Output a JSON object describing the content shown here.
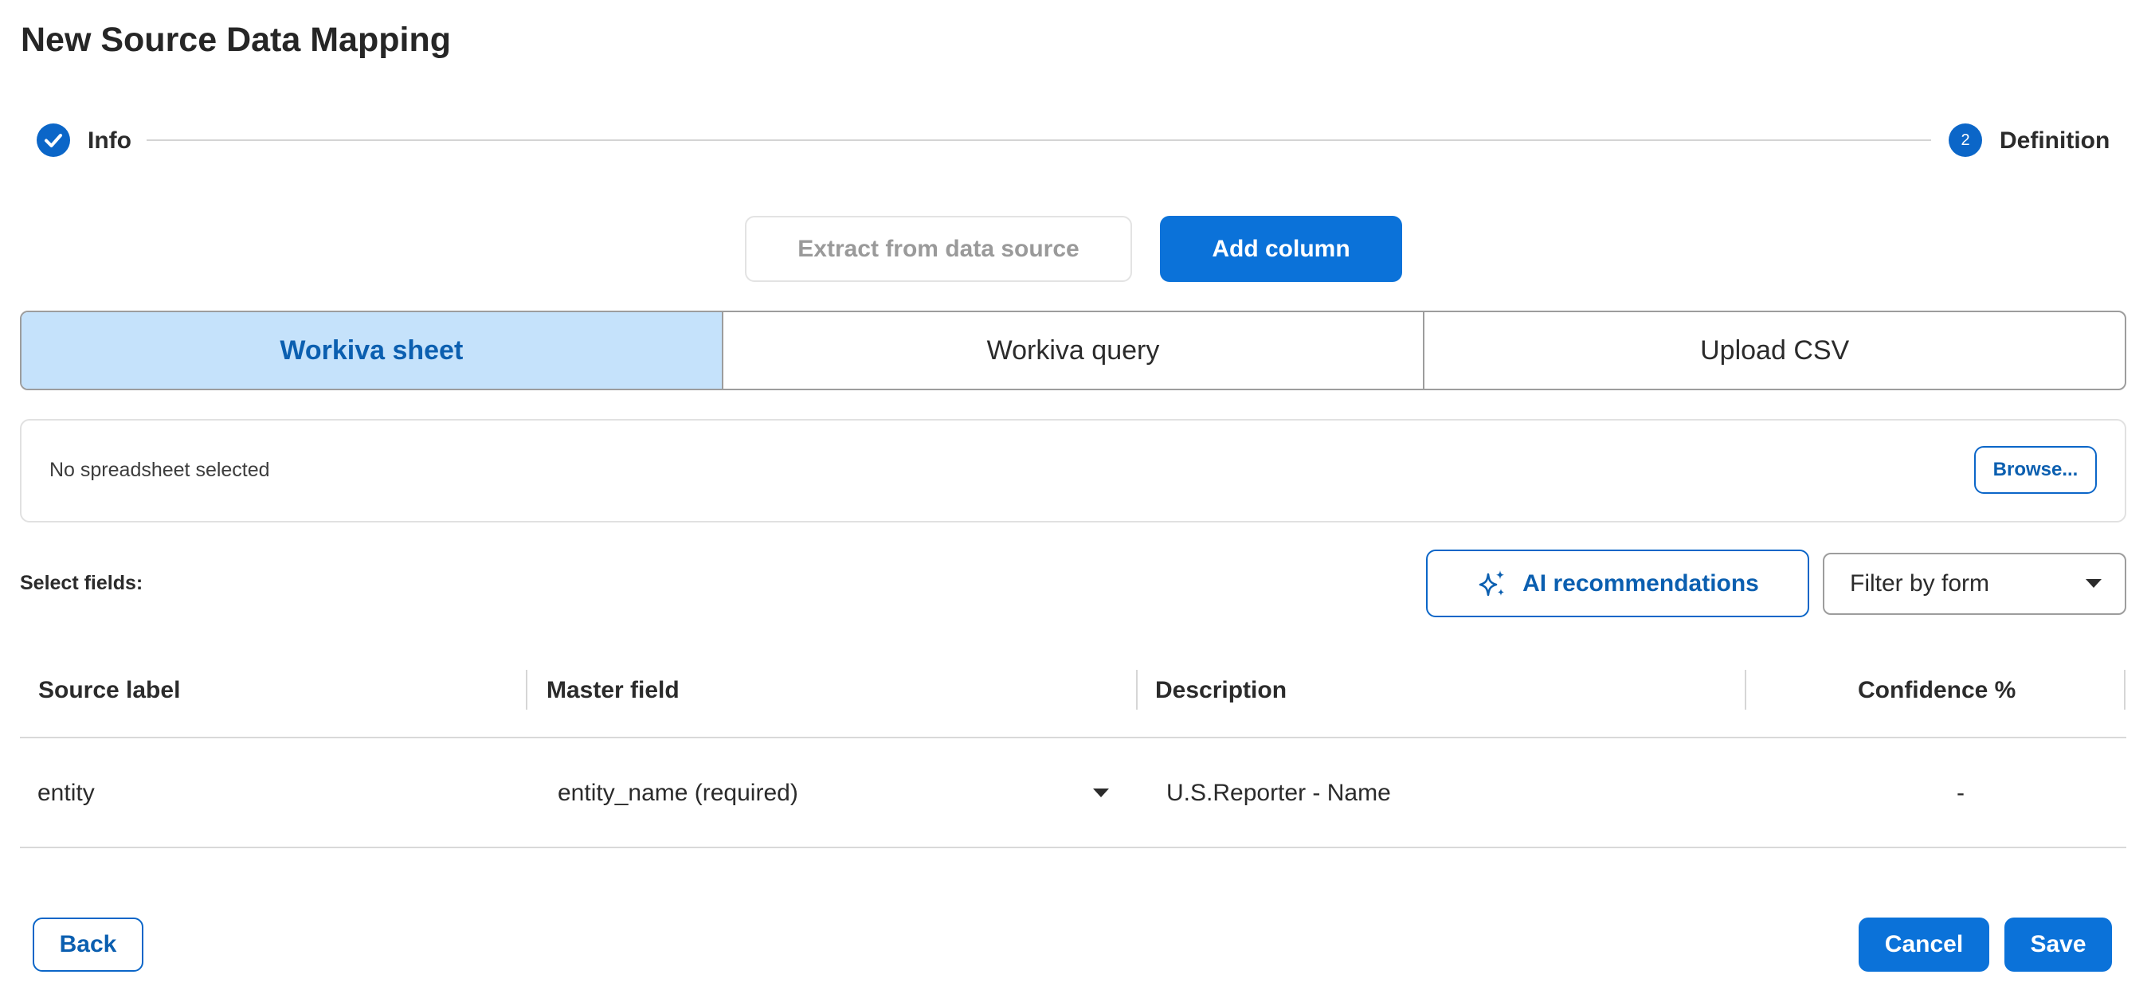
{
  "dialog": {
    "title": "New Source Data Mapping"
  },
  "stepper": {
    "step1": {
      "label": "Info",
      "state": "completed",
      "icon": "check-icon"
    },
    "step2": {
      "number": "2",
      "label": "Definition",
      "state": "active"
    }
  },
  "actions": {
    "extract_label": "Extract from data source",
    "add_column_label": "Add column"
  },
  "source_tabs": [
    {
      "label": "Workiva sheet",
      "selected": true
    },
    {
      "label": "Workiva query",
      "selected": false
    },
    {
      "label": "Upload CSV",
      "selected": false
    }
  ],
  "spreadsheet": {
    "status_text": "No spreadsheet selected",
    "browse_label": "Browse..."
  },
  "fields": {
    "label": "Select fields:",
    "ai_button_label": "AI recommendations",
    "ai_icon": "sparkle-icon",
    "filter_value": "Filter by form"
  },
  "table": {
    "columns": [
      "Source label",
      "Master field",
      "Description",
      "Confidence %"
    ],
    "rows": [
      {
        "source_label": "entity",
        "master_field": "entity_name (required)",
        "description": "U.S.Reporter - Name",
        "confidence": "-"
      }
    ]
  },
  "footer": {
    "back_label": "Back",
    "cancel_label": "Cancel",
    "save_label": "Save"
  },
  "colors": {
    "primary": "#0b72d9",
    "primary_text": "#0b5fb0",
    "tab_selected_bg": "#c5e2fb"
  }
}
